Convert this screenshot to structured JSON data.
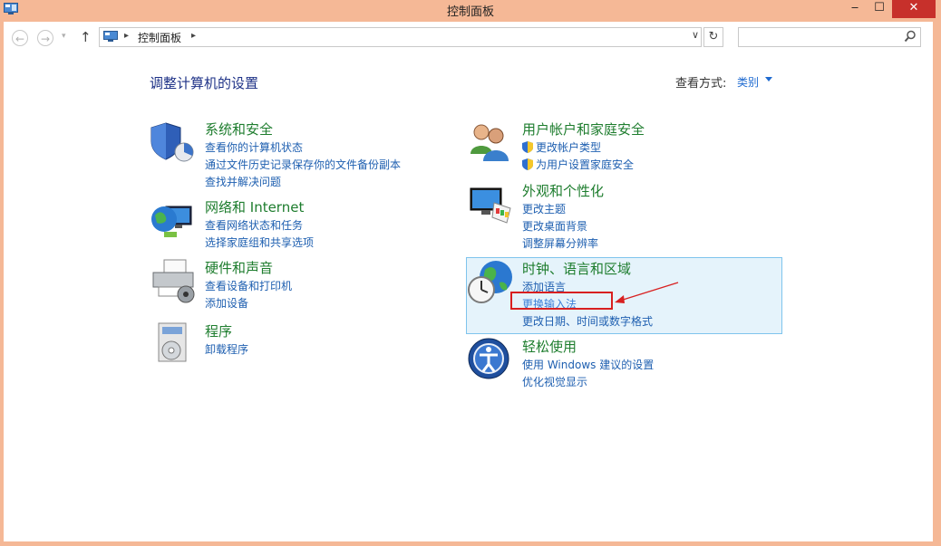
{
  "window": {
    "title": "控制面板",
    "minimize_symbol": "‒",
    "maximize_symbol": "☐",
    "close_symbol": "✕"
  },
  "addressbar": {
    "back_symbol": "←",
    "forward_symbol": "→",
    "history_symbol": "▾",
    "up_symbol": "↑",
    "separator": "▸",
    "path": "控制面板",
    "dropdown_symbol": "∨",
    "refresh_symbol": "↻",
    "search_placeholder": ""
  },
  "header": {
    "title": "调整计算机的设置",
    "view_label": "查看方式:",
    "view_value": "类别"
  },
  "categories": [
    {
      "title": "系统和安全",
      "icon": "shield-icon",
      "links": [
        "查看你的计算机状态",
        "通过文件历史记录保存你的文件备份副本",
        "查找并解决问题"
      ]
    },
    {
      "title": "网络和 Internet",
      "icon": "network-globe-icon",
      "links": [
        "查看网络状态和任务",
        "选择家庭组和共享选项"
      ]
    },
    {
      "title": "硬件和声音",
      "icon": "printer-icon",
      "links": [
        "查看设备和打印机",
        "添加设备"
      ]
    },
    {
      "title": "程序",
      "icon": "program-disc-icon",
      "links": [
        "卸载程序"
      ]
    },
    {
      "title": "用户帐户和家庭安全",
      "icon": "users-icon",
      "links": [
        "更改帐户类型",
        "为用户设置家庭安全"
      ]
    },
    {
      "title": "外观和个性化",
      "icon": "monitor-palette-icon",
      "links": [
        "更改主题",
        "更改桌面背景",
        "调整屏幕分辨率"
      ]
    },
    {
      "title": "时钟、语言和区域",
      "icon": "clock-globe-icon",
      "links": [
        "添加语言",
        "更换输入法",
        "更改日期、时间或数字格式"
      ]
    },
    {
      "title": "轻松使用",
      "icon": "ease-of-access-icon",
      "links": [
        "使用 Windows 建议的设置",
        "优化视觉显示"
      ]
    }
  ],
  "colors": {
    "titlebar": "#f5b896",
    "category_title": "#1e7d2e",
    "link": "#1e5fb0",
    "highlight": "#e5f3fb",
    "annotation": "#d82020"
  }
}
